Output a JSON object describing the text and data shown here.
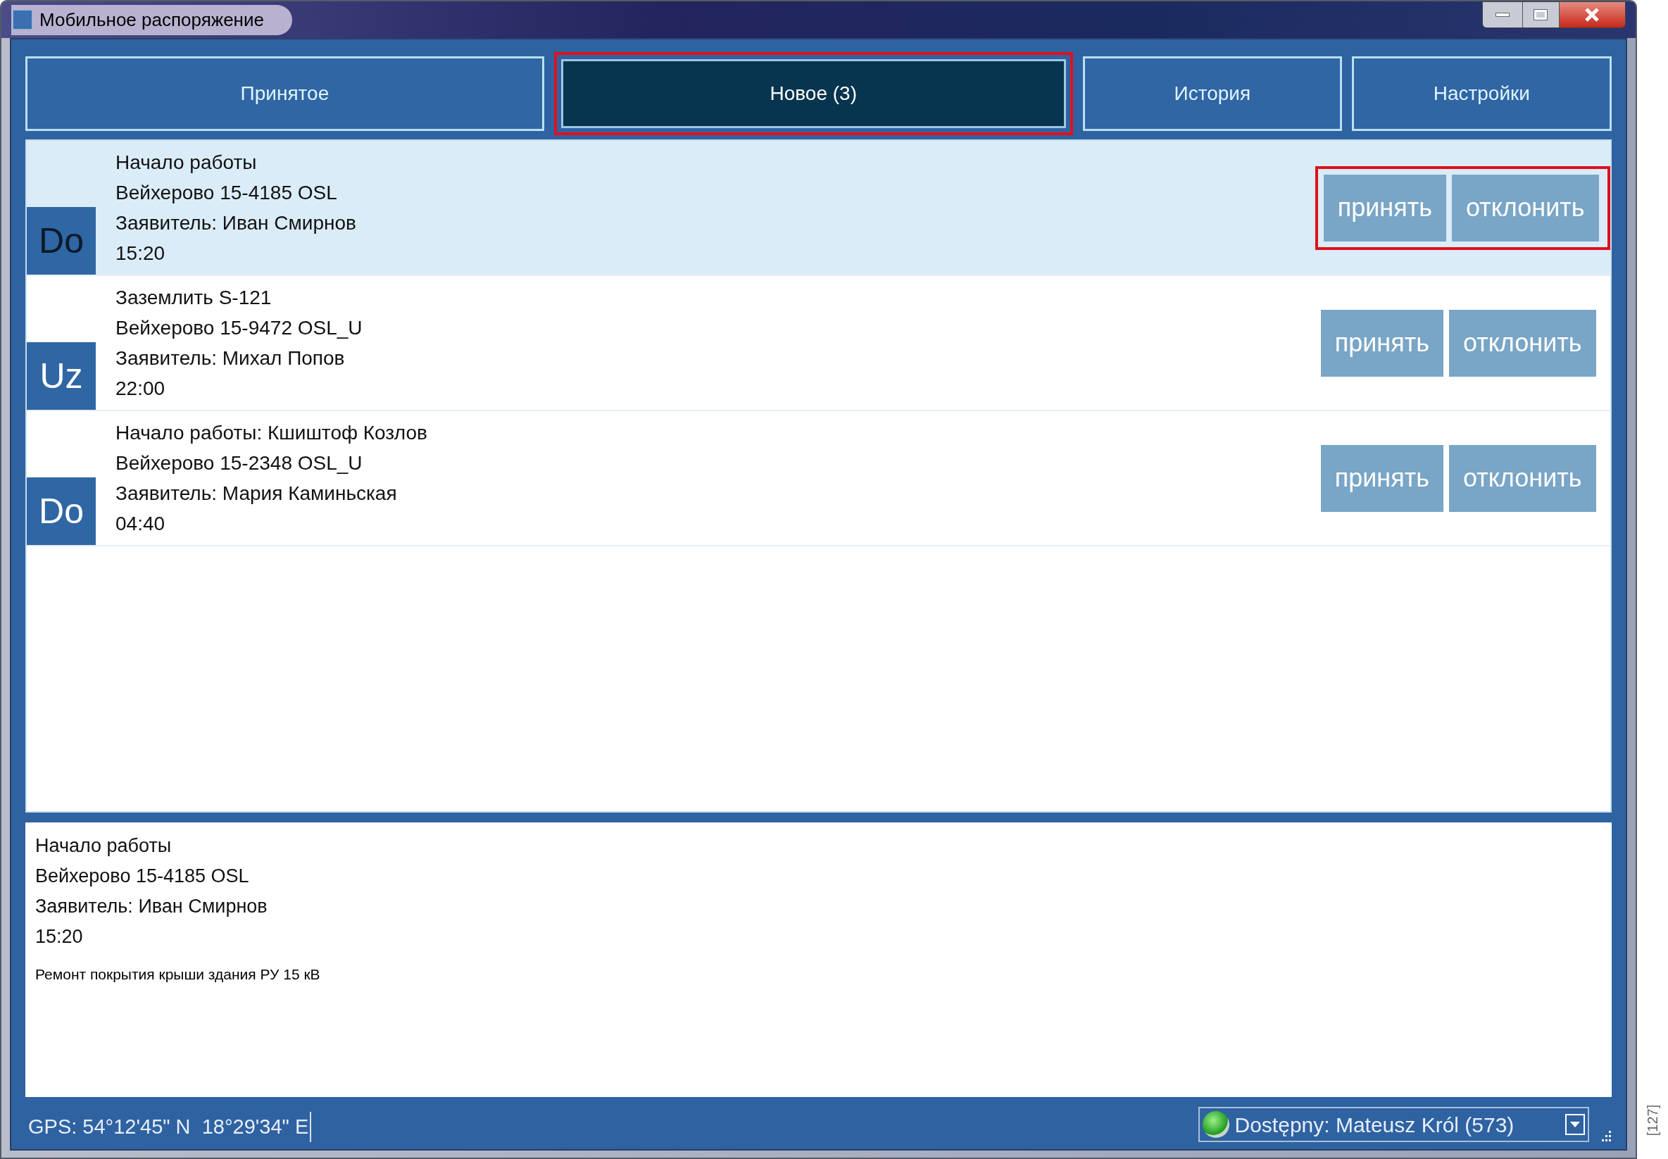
{
  "window": {
    "title": "Мобильное распоряжение"
  },
  "tabs": [
    {
      "label": "Принятое",
      "selected": false,
      "highlighted": false
    },
    {
      "label": "Новое (3)",
      "selected": true,
      "highlighted": true
    },
    {
      "label": "История",
      "selected": false,
      "highlighted": false
    },
    {
      "label": "Настройки",
      "selected": false,
      "highlighted": false
    }
  ],
  "orders": [
    {
      "badge": "Do",
      "lines": [
        "Начало работы",
        "Вейхерово 15-4185 OSL",
        "Заявитель: Иван Смирнов",
        "15:20"
      ],
      "selected": true,
      "highlighted": true,
      "buttons": [
        "принять",
        "отклонить"
      ]
    },
    {
      "badge": "Uz",
      "lines": [
        "Заземлить S-121",
        "Вейхерово 15-9472 OSL_U",
        "Заявитель: Михал Попов",
        "22:00"
      ],
      "selected": false,
      "highlighted": false,
      "buttons": [
        "принять",
        "отклонить"
      ]
    },
    {
      "badge": "Do",
      "lines": [
        "Начало работы: Кшиштоф Козлов",
        "Вейхерово 15-2348 OSL_U",
        "Заявитель: Мария Каминьская",
        "04:40"
      ],
      "selected": false,
      "highlighted": false,
      "buttons": [
        "принять",
        "отклонить"
      ]
    }
  ],
  "details": {
    "lines": [
      "Начало работы",
      "Вейхерово 15-4185 OSL",
      "Заявитель: Иван Смирнов",
      "15:20"
    ],
    "description": "Ремонт покрытия крыши здания РУ 15 кВ"
  },
  "status_bar": {
    "gps": "GPS: 54°12'45\" N  18°29'34\" E",
    "status": "Dostępny: Mateusz Król (573)"
  },
  "figure_ref": "[127]"
}
